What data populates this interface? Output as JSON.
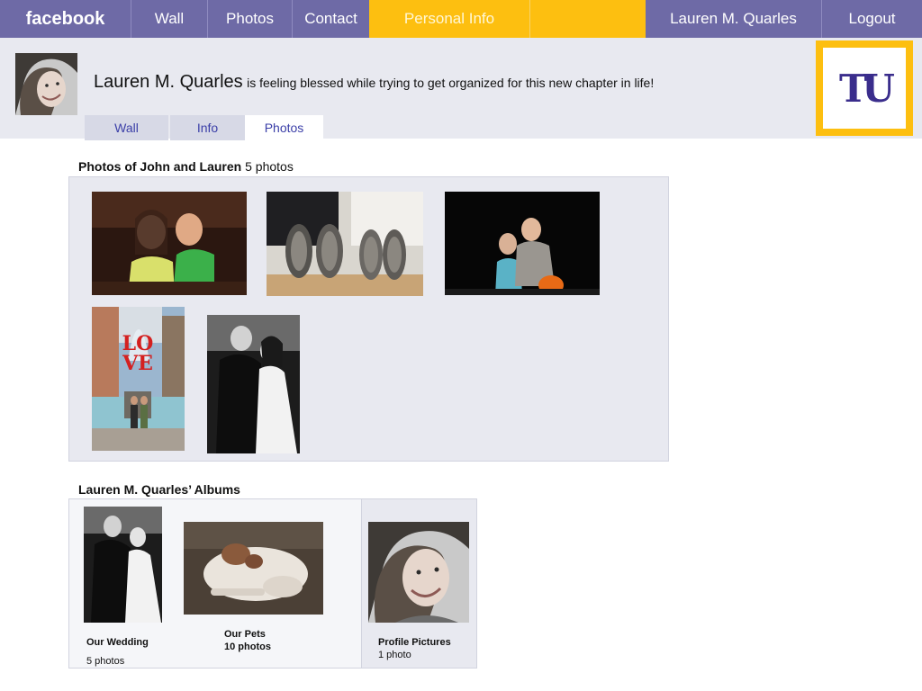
{
  "nav": {
    "brand": "facebook",
    "wall": "Wall",
    "photos": "Photos",
    "contact": "Contact",
    "personal_info": "Personal Info",
    "user_name": "Lauren M. Quarles",
    "logout": "Logout"
  },
  "profile": {
    "name": "Lauren M. Quarles",
    "status": "is feeling blessed while trying to get organized for this new chapter in life!"
  },
  "tabs": {
    "wall": "Wall",
    "info": "Info",
    "photos": "Photos"
  },
  "logo": {
    "text": "TU"
  },
  "photos_section": {
    "title": "Photos of John and Lauren",
    "count": "5 photos"
  },
  "albums_section": {
    "title": "Lauren M. Quarles’ Albums",
    "albums": [
      {
        "name": "Our Wedding",
        "count": "5 photos"
      },
      {
        "name": "Our Pets",
        "count": "10 photos"
      },
      {
        "name": "Profile Pictures",
        "count": "1 photo"
      }
    ]
  },
  "colors": {
    "nav_background": "#6e6aa6",
    "nav_active": "#fdbf10",
    "header_band": "#e8e9f0",
    "tab_link": "#3b3fa8",
    "logo_purple": "#3a2d8c"
  }
}
